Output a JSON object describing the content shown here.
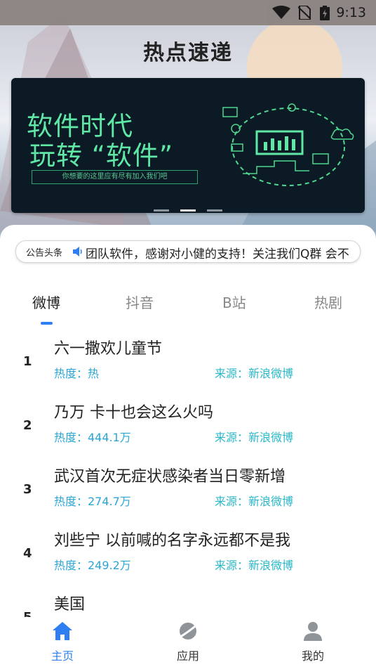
{
  "status_bar": {
    "time": "9:13"
  },
  "header": {
    "title": "热点速递"
  },
  "banner": {
    "line1": "软件时代",
    "line2": "玩转 “软件”",
    "tagline": "你想要的这里应有尽有加入我们吧",
    "page_count": 3,
    "active_page": 2
  },
  "notice": {
    "tag": "公告头条",
    "message": "团队软件，感谢对小健的支持！关注我们Q群 会不"
  },
  "tabs": [
    {
      "label": "微博"
    },
    {
      "label": "抖音"
    },
    {
      "label": "B站"
    },
    {
      "label": "热剧"
    }
  ],
  "list": [
    {
      "rank": "1",
      "title": "六一撒欢儿童节",
      "heat": "热度：热",
      "source": "来源：新浪微博"
    },
    {
      "rank": "2",
      "title": "乃万 卡十也会这么火吗",
      "heat": "热度：444.1万",
      "source": "来源：新浪微博"
    },
    {
      "rank": "3",
      "title": "武汉首次无症状感染者当日零新增",
      "heat": "热度：274.7万",
      "source": "来源：新浪微博"
    },
    {
      "rank": "4",
      "title": "刘些宁 以前喊的名字永远都不是我",
      "heat": "热度：249.2万",
      "source": "来源：新浪微博"
    },
    {
      "rank": "5",
      "title": "美国",
      "heat": "",
      "source": ""
    }
  ],
  "bottom_nav": [
    {
      "label": "主页",
      "icon": "home-icon"
    },
    {
      "label": "应用",
      "icon": "planet-icon"
    },
    {
      "label": "我的",
      "icon": "user-icon"
    }
  ],
  "colors": {
    "accent": "#2f7ff2",
    "heat": "#2aa6d4",
    "source": "#2ab8c9",
    "banner_green": "#5fe7a6"
  }
}
